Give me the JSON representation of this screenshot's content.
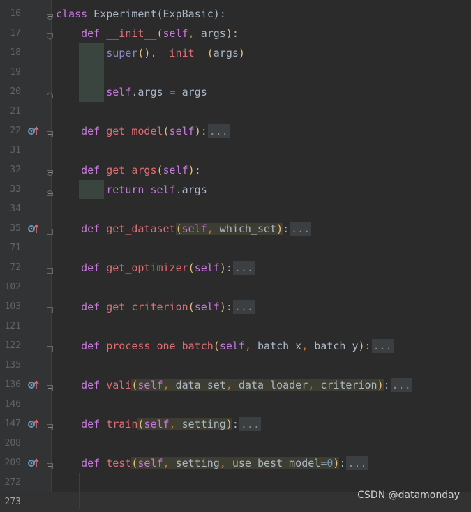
{
  "editor": {
    "lines": [
      {
        "num": "16",
        "marker": "",
        "fold": "open",
        "code": [
          [
            "kw2",
            "class "
          ],
          [
            "plain",
            "Experiment(ExpBasic):"
          ]
        ]
      },
      {
        "num": "17",
        "marker": "",
        "fold": "open",
        "code": [
          [
            "plain",
            "    "
          ],
          [
            "kw2",
            "def "
          ],
          [
            "fn",
            "__init__"
          ],
          [
            "paren",
            "("
          ],
          [
            "self",
            "self"
          ],
          [
            "punc",
            ", "
          ],
          [
            "plain",
            "args"
          ],
          [
            "paren",
            ")"
          ],
          [
            "plain",
            ":"
          ]
        ]
      },
      {
        "num": "18",
        "marker": "",
        "fold": "",
        "indent": true,
        "code": [
          [
            "plain",
            "        "
          ],
          [
            "builtin",
            "super"
          ],
          [
            "paren",
            "()"
          ],
          [
            "plain",
            "."
          ],
          [
            "fn",
            "__init__"
          ],
          [
            "paren",
            "("
          ],
          [
            "plain",
            "args"
          ],
          [
            "paren",
            ")"
          ]
        ]
      },
      {
        "num": "19",
        "marker": "",
        "fold": "",
        "indent": true,
        "code": []
      },
      {
        "num": "20",
        "marker": "",
        "fold": "close",
        "indent": true,
        "code": [
          [
            "plain",
            "        "
          ],
          [
            "self",
            "self"
          ],
          [
            "plain",
            ".args = args"
          ]
        ]
      },
      {
        "num": "21",
        "marker": "",
        "fold": "",
        "code": []
      },
      {
        "num": "22",
        "marker": "override",
        "fold": "plus",
        "code": [
          [
            "plain",
            "    "
          ],
          [
            "kw2",
            "def "
          ],
          [
            "fn",
            "get_model"
          ],
          [
            "paren",
            "("
          ],
          [
            "self",
            "self"
          ],
          [
            "paren",
            ")"
          ],
          [
            "plain",
            ":"
          ],
          [
            "fold",
            "..."
          ]
        ]
      },
      {
        "num": "31",
        "marker": "",
        "fold": "",
        "code": []
      },
      {
        "num": "32",
        "marker": "",
        "fold": "open",
        "code": [
          [
            "plain",
            "    "
          ],
          [
            "kw2",
            "def "
          ],
          [
            "fn",
            "get_args"
          ],
          [
            "paren",
            "("
          ],
          [
            "self",
            "self"
          ],
          [
            "paren",
            ")"
          ],
          [
            "plain",
            ":"
          ]
        ]
      },
      {
        "num": "33",
        "marker": "",
        "fold": "close",
        "indent": true,
        "code": [
          [
            "plain",
            "        "
          ],
          [
            "kw2",
            "return "
          ],
          [
            "self",
            "self"
          ],
          [
            "plain",
            ".args"
          ]
        ]
      },
      {
        "num": "34",
        "marker": "",
        "fold": "",
        "code": []
      },
      {
        "num": "35",
        "marker": "override",
        "fold": "plus",
        "code": [
          [
            "plain",
            "    "
          ],
          [
            "kw2",
            "def "
          ],
          [
            "fn",
            "get_dataset"
          ],
          [
            "hl",
            [
              [
                "paren",
                "("
              ],
              [
                "self",
                "self"
              ],
              [
                "punc",
                ", "
              ],
              [
                "plain",
                "which_set"
              ],
              [
                "paren",
                ")"
              ]
            ]
          ],
          [
            "plain",
            ":"
          ],
          [
            "fold",
            "..."
          ]
        ]
      },
      {
        "num": "71",
        "marker": "",
        "fold": "",
        "code": []
      },
      {
        "num": "72",
        "marker": "",
        "fold": "plus",
        "code": [
          [
            "plain",
            "    "
          ],
          [
            "kw2",
            "def "
          ],
          [
            "fn",
            "get_optimizer"
          ],
          [
            "paren",
            "("
          ],
          [
            "self",
            "self"
          ],
          [
            "paren",
            ")"
          ],
          [
            "plain",
            ":"
          ],
          [
            "fold",
            "..."
          ]
        ]
      },
      {
        "num": "102",
        "marker": "",
        "fold": "",
        "code": []
      },
      {
        "num": "103",
        "marker": "",
        "fold": "plus",
        "code": [
          [
            "plain",
            "    "
          ],
          [
            "kw2",
            "def "
          ],
          [
            "fn",
            "get_criterion"
          ],
          [
            "paren",
            "("
          ],
          [
            "self",
            "self"
          ],
          [
            "paren",
            ")"
          ],
          [
            "plain",
            ":"
          ],
          [
            "fold",
            "..."
          ]
        ]
      },
      {
        "num": "121",
        "marker": "",
        "fold": "",
        "code": []
      },
      {
        "num": "122",
        "marker": "",
        "fold": "plus",
        "code": [
          [
            "plain",
            "    "
          ],
          [
            "kw2",
            "def "
          ],
          [
            "fn",
            "process_one_batch"
          ],
          [
            "paren",
            "("
          ],
          [
            "self",
            "self"
          ],
          [
            "punc",
            ", "
          ],
          [
            "plain",
            "batch_x"
          ],
          [
            "punc",
            ", "
          ],
          [
            "plain",
            "batch_y"
          ],
          [
            "paren",
            ")"
          ],
          [
            "plain",
            ":"
          ],
          [
            "fold",
            "..."
          ]
        ]
      },
      {
        "num": "135",
        "marker": "",
        "fold": "",
        "code": []
      },
      {
        "num": "136",
        "marker": "override",
        "fold": "plus",
        "code": [
          [
            "plain",
            "    "
          ],
          [
            "kw2",
            "def "
          ],
          [
            "fn",
            "vali"
          ],
          [
            "hl",
            [
              [
                "paren",
                "("
              ],
              [
                "self",
                "self"
              ],
              [
                "punc",
                ", "
              ],
              [
                "plain",
                "data_set"
              ],
              [
                "punc",
                ", "
              ],
              [
                "plain",
                "data_loader"
              ],
              [
                "punc",
                ", "
              ],
              [
                "plain",
                "criterion"
              ],
              [
                "paren",
                ")"
              ]
            ]
          ],
          [
            "plain",
            ":"
          ],
          [
            "fold",
            "..."
          ]
        ]
      },
      {
        "num": "146",
        "marker": "",
        "fold": "",
        "code": []
      },
      {
        "num": "147",
        "marker": "override",
        "fold": "plus",
        "code": [
          [
            "plain",
            "    "
          ],
          [
            "kw2",
            "def "
          ],
          [
            "fn",
            "train"
          ],
          [
            "hl",
            [
              [
                "paren",
                "("
              ],
              [
                "self",
                "self"
              ],
              [
                "punc",
                ", "
              ],
              [
                "plain",
                "setting"
              ],
              [
                "paren",
                ")"
              ]
            ]
          ],
          [
            "plain",
            ":"
          ],
          [
            "fold",
            "..."
          ]
        ]
      },
      {
        "num": "208",
        "marker": "",
        "fold": "",
        "code": []
      },
      {
        "num": "209",
        "marker": "override",
        "fold": "plus",
        "code": [
          [
            "plain",
            "    "
          ],
          [
            "kw2",
            "def "
          ],
          [
            "fn",
            "test"
          ],
          [
            "hl",
            [
              [
                "paren",
                "("
              ],
              [
                "self",
                "self"
              ],
              [
                "punc",
                ", "
              ],
              [
                "plain",
                "setting"
              ],
              [
                "punc",
                ", "
              ],
              [
                "plain",
                "use_best_model="
              ],
              [
                "num",
                "0"
              ],
              [
                "paren",
                ")"
              ]
            ]
          ],
          [
            "plain",
            ":"
          ],
          [
            "fold",
            "..."
          ]
        ]
      },
      {
        "num": "272",
        "marker": "",
        "fold": "",
        "code": []
      },
      {
        "num": "273",
        "marker": "",
        "fold": "",
        "current": true,
        "code": []
      }
    ]
  },
  "watermark": "CSDN @datamonday",
  "colors": {
    "background": "#2b2b2b",
    "gutter": "#313335",
    "keyword": "#c678dd",
    "function": "#e06c75",
    "paren": "#e5c07b",
    "override_icon": "#6897bb",
    "override_arrow": "#e06c75"
  }
}
